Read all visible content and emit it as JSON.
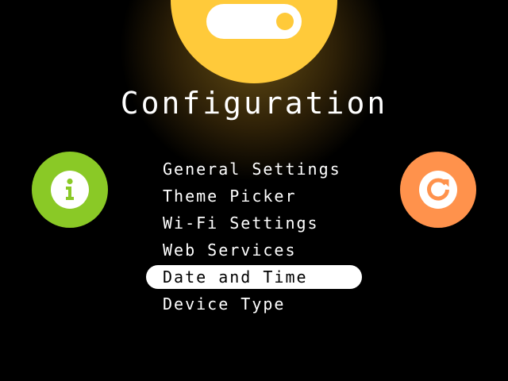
{
  "app": {
    "title": "Configuration"
  },
  "colors": {
    "background": "#000000",
    "header_badge": "#ffca3a",
    "info_button": "#8ac926",
    "refresh_button": "#ff924c",
    "text": "#ffffff",
    "selection_bg": "#ffffff",
    "selection_text": "#000000"
  },
  "header": {
    "icon": "toggle-switch-icon",
    "toggle_state": "on"
  },
  "left_button": {
    "icon": "info-icon"
  },
  "right_button": {
    "icon": "refresh-icon"
  },
  "menu": {
    "selected_index": 4,
    "items": [
      {
        "label": "General Settings"
      },
      {
        "label": "Theme Picker"
      },
      {
        "label": "Wi-Fi Settings"
      },
      {
        "label": "Web Services"
      },
      {
        "label": "Date and Time"
      },
      {
        "label": "Device Type"
      }
    ]
  }
}
